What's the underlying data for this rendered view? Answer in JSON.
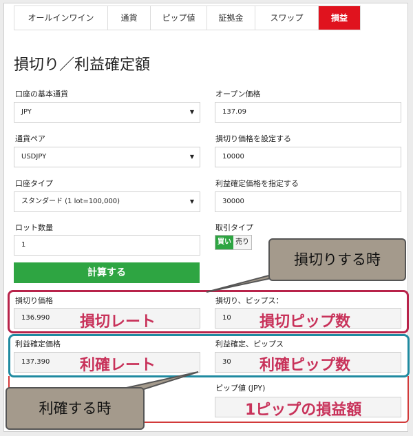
{
  "tabs": [
    {
      "label": "オールインワイン",
      "active": false
    },
    {
      "label": "通貨",
      "active": false
    },
    {
      "label": "ピップ値",
      "active": false
    },
    {
      "label": "証拠金",
      "active": false
    },
    {
      "label": "スワップ",
      "active": false
    },
    {
      "label": "損益",
      "active": true
    }
  ],
  "title": "損切り／利益確定額",
  "form": {
    "base_currency": {
      "label": "口座の基本通貨",
      "value": "JPY"
    },
    "currency_pair": {
      "label": "通貨ペア",
      "value": "USDJPY"
    },
    "account_type": {
      "label": "口座タイプ",
      "value": "スタンダード (1 lot=100,000)"
    },
    "lot": {
      "label": "ロット数量",
      "value": "1"
    },
    "open_price": {
      "label": "オープン価格",
      "value": "137.09"
    },
    "stop_loss": {
      "label": "損切り価格を設定する",
      "value": "10000"
    },
    "take_profit": {
      "label": "利益確定価格を指定する",
      "value": "30000"
    },
    "trade_type": {
      "label": "取引タイプ",
      "buy": "買い",
      "sell": "売り",
      "selected": "買い"
    },
    "calc_button": "計算する"
  },
  "results": {
    "sl_price": {
      "label": "損切り価格",
      "value": "136.990",
      "annotation": "損切レート"
    },
    "sl_pips": {
      "label": "損切り、ピップス：",
      "value": "10",
      "annotation": "損切ピップ数"
    },
    "tp_price": {
      "label": "利益確定価格",
      "value": "137.390",
      "annotation": "利確レート"
    },
    "tp_pips": {
      "label": "利益確定、ピップス",
      "value": "30",
      "annotation": "利確ピップ数"
    },
    "pip_value": {
      "label": "ピップ値 (JPY)",
      "annotation": "1ピップの損益額"
    }
  },
  "callouts": {
    "loss": "損切りする時",
    "profit": "利確する時"
  },
  "colors": {
    "tab_active": "#e0131e",
    "calc_button": "#2ea542",
    "loss_frame": "#b8234a",
    "profit_frame": "#1f8aa0",
    "annotation_text": "#c8325a",
    "callout_bg": "#a49a8c"
  }
}
